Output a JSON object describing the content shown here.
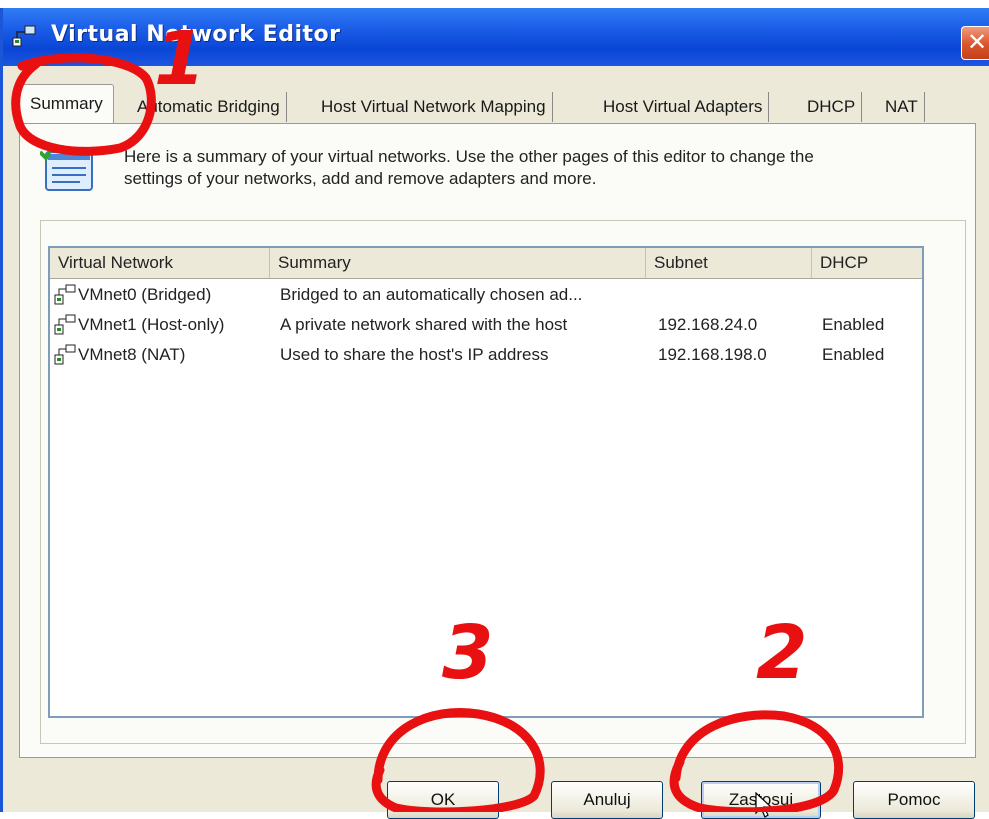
{
  "window": {
    "title": "Virtual Network Editor",
    "close_symbol": "✕"
  },
  "tabs": [
    {
      "label": "Summary",
      "active": true
    },
    {
      "label": "Automatic Bridging",
      "active": false
    },
    {
      "label": "Host Virtual Network Mapping",
      "active": false
    },
    {
      "label": "Host Virtual Adapters",
      "active": false
    },
    {
      "label": "DHCP",
      "active": false
    },
    {
      "label": "NAT",
      "active": false
    }
  ],
  "summary": {
    "intro_line1": "Here is a summary of your virtual networks. Use the other pages of this editor to change the",
    "intro_line2": "settings of your networks, add and remove adapters and more.",
    "columns": [
      "Virtual Network",
      "Summary",
      "Subnet",
      "DHCP"
    ],
    "rows": [
      {
        "network": "VMnet0 (Bridged)",
        "summary": "Bridged to an automatically chosen ad...",
        "subnet": "",
        "dhcp": ""
      },
      {
        "network": "VMnet1 (Host-only)",
        "summary": "A private network shared with the host",
        "subnet": "192.168.24.0",
        "dhcp": "Enabled"
      },
      {
        "network": "VMnet8 (NAT)",
        "summary": "Used to share the host's IP address",
        "subnet": "192.168.198.0",
        "dhcp": "Enabled"
      }
    ]
  },
  "buttons": {
    "ok": "OK",
    "cancel": "Anuluj",
    "apply": "Zastosuj",
    "help": "Pomoc"
  },
  "annotations": {
    "step1": "1",
    "step2": "2",
    "step3": "3",
    "color": "#e81010"
  },
  "icons": {
    "title": "network-icon",
    "info": "list-summary-icon",
    "row": "network-adapter-icon",
    "cursor": "mouse-pointer-icon"
  }
}
